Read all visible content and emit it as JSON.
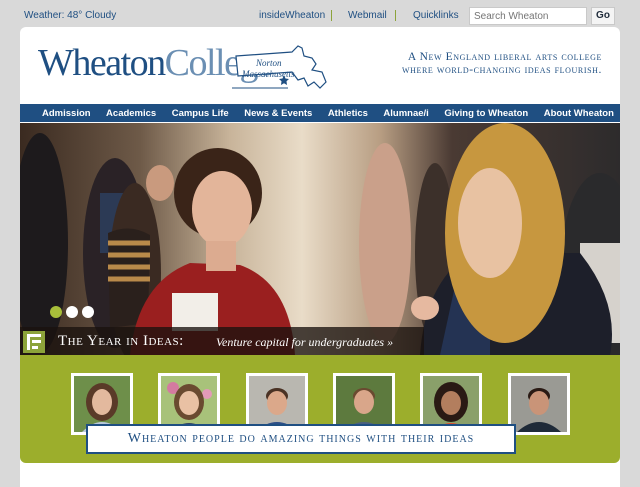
{
  "topbar": {
    "weather": "Weather: 48° Cloudy",
    "links": [
      "insideWheaton",
      "Webmail",
      "Quicklinks"
    ],
    "search_placeholder": "Search Wheaton",
    "go_label": "Go"
  },
  "header": {
    "logo_part1": "Wheaton",
    "logo_part2": "College",
    "location_line1": "Norton",
    "location_line2": "Massachusetts",
    "tagline_line1": "A New England liberal arts college",
    "tagline_line2": "where world-changing ideas flourish."
  },
  "nav": {
    "items": [
      "Admission",
      "Academics",
      "Campus Life",
      "News & Events",
      "Athletics",
      "Alumnae/i",
      "Giving to Wheaton",
      "About Wheaton"
    ]
  },
  "hero": {
    "caption_lead": "The Year in Ideas:",
    "caption_sub": "Venture capital for undergraduates »",
    "slides_count": 3,
    "active_slide": 1
  },
  "profiles": {
    "count": 6,
    "banner": "Wheaton people do amazing things with their ideas"
  },
  "colors": {
    "brand_blue": "#1f4f82",
    "accent_green": "#9cae2c",
    "background": "#d9d9d9"
  }
}
